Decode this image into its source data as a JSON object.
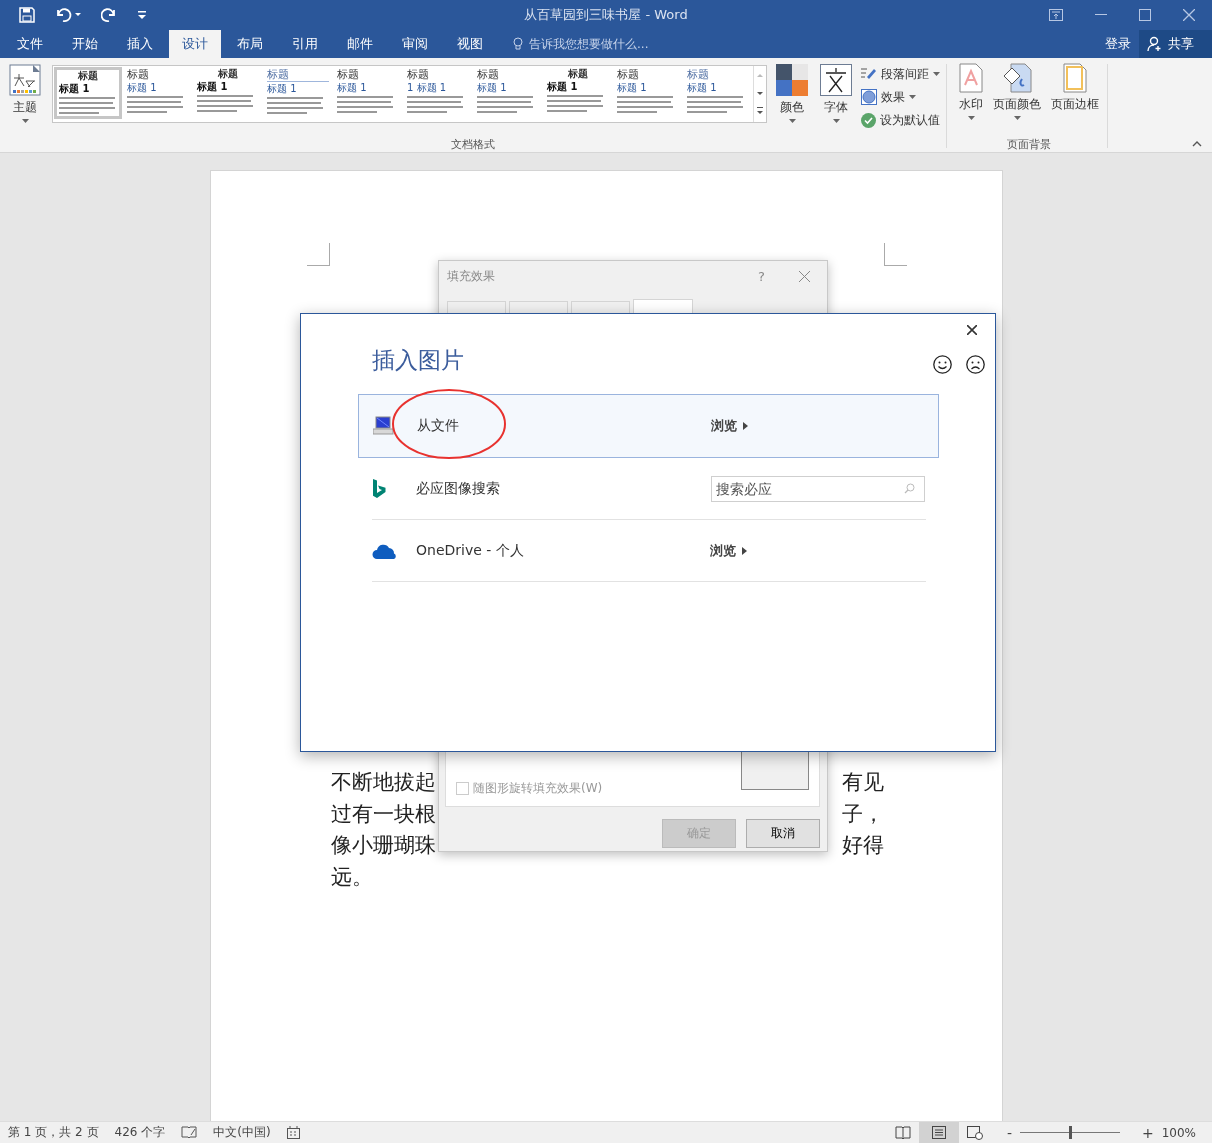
{
  "window": {
    "title": "从百草园到三味书屋 - Word"
  },
  "ribbon_tabs": [
    {
      "label": "文件",
      "selected": false
    },
    {
      "label": "开始",
      "selected": false
    },
    {
      "label": "插入",
      "selected": false
    },
    {
      "label": "设计",
      "selected": true
    },
    {
      "label": "布局",
      "selected": false
    },
    {
      "label": "引用",
      "selected": false
    },
    {
      "label": "邮件",
      "selected": false
    },
    {
      "label": "审阅",
      "selected": false
    },
    {
      "label": "视图",
      "selected": false
    }
  ],
  "tell_me": {
    "placeholder": "告诉我您想要做什么..."
  },
  "account": {
    "sign_in": "登录",
    "share": "共享"
  },
  "ribbon": {
    "theme": "主题",
    "style_gallery": [
      {
        "title": "标题",
        "heading": "标题 1",
        "kind": "boxed",
        "selected": true
      },
      {
        "title": "标题",
        "heading": "标题 1",
        "kind": "large",
        "selected": false
      },
      {
        "title": "标题",
        "heading": "标题 1",
        "kind": "small",
        "selected": false
      },
      {
        "title": "标题",
        "heading": "标题 1",
        "kind": "lined",
        "selected": false
      },
      {
        "title": "标题",
        "heading": "标题 1",
        "kind": "large",
        "selected": false
      },
      {
        "title": "标题",
        "heading": "1 标题 1",
        "kind": "large",
        "selected": false
      },
      {
        "title": "标题",
        "heading": "标题 1",
        "kind": "large",
        "selected": false
      },
      {
        "title": "标题",
        "heading": "标题 1",
        "kind": "small",
        "selected": false
      },
      {
        "title": "标题",
        "heading": "标题 1",
        "kind": "large",
        "selected": false
      },
      {
        "title": "标题",
        "heading": "标题 1",
        "kind": "blue",
        "selected": false
      }
    ],
    "format_group": "文档格式",
    "colors": "颜色",
    "fonts": "字体",
    "side_items": [
      {
        "label": "段落间距",
        "kind": "spacing",
        "dropdown": true
      },
      {
        "label": "效果",
        "kind": "effects",
        "dropdown": true
      },
      {
        "label": "设为默认值",
        "kind": "default",
        "dropdown": false
      }
    ],
    "background_items": [
      {
        "label": "水印",
        "kind": "watermark"
      },
      {
        "label": "页面颜色",
        "kind": "pagecolor"
      },
      {
        "label": "页面边框",
        "kind": "border"
      }
    ],
    "background_group": "页面背景"
  },
  "document": {
    "lines": [
      {
        "left": "不断地拔起",
        "right": "有见"
      },
      {
        "left": "过有一块根",
        "right": "子，"
      },
      {
        "left": "像小珊瑚珠",
        "right": "好得"
      },
      {
        "left": "远。"
      }
    ]
  },
  "fill_dialog": {
    "title": "填充效果",
    "help": "?",
    "tabs": [
      {
        "selected": false
      },
      {
        "selected": false
      },
      {
        "selected": false
      },
      {
        "selected": true
      }
    ],
    "checkbox": {
      "label": "随图形旋转填充效果(W)",
      "checked": false,
      "disabled": true
    },
    "buttons": [
      {
        "label": "确定",
        "disabled": true
      },
      {
        "label": "取消",
        "disabled": false
      }
    ]
  },
  "insert_dialog": {
    "title": "插入图片",
    "rows": [
      {
        "kind": "file",
        "label": "从文件",
        "action": "浏览",
        "selected": true,
        "circled": true
      },
      {
        "kind": "bing",
        "label": "必应图像搜索",
        "placeholder": "搜索必应",
        "selected": false,
        "circled": false
      },
      {
        "kind": "onedrive",
        "label": "OneDrive - 个人",
        "action": "浏览",
        "selected": false,
        "circled": false
      }
    ]
  },
  "status_bar": {
    "page": "第 1 页，共 2 页",
    "words": "426 个字",
    "language": "中文(中国)",
    "views": [
      {
        "kind": "read",
        "selected": false
      },
      {
        "kind": "print",
        "selected": true
      },
      {
        "kind": "web",
        "selected": false
      }
    ],
    "zoom_minus": "-",
    "zoom_plus": "+",
    "zoom": {
      "level": 0.5
    },
    "zoom_text": "100%"
  }
}
